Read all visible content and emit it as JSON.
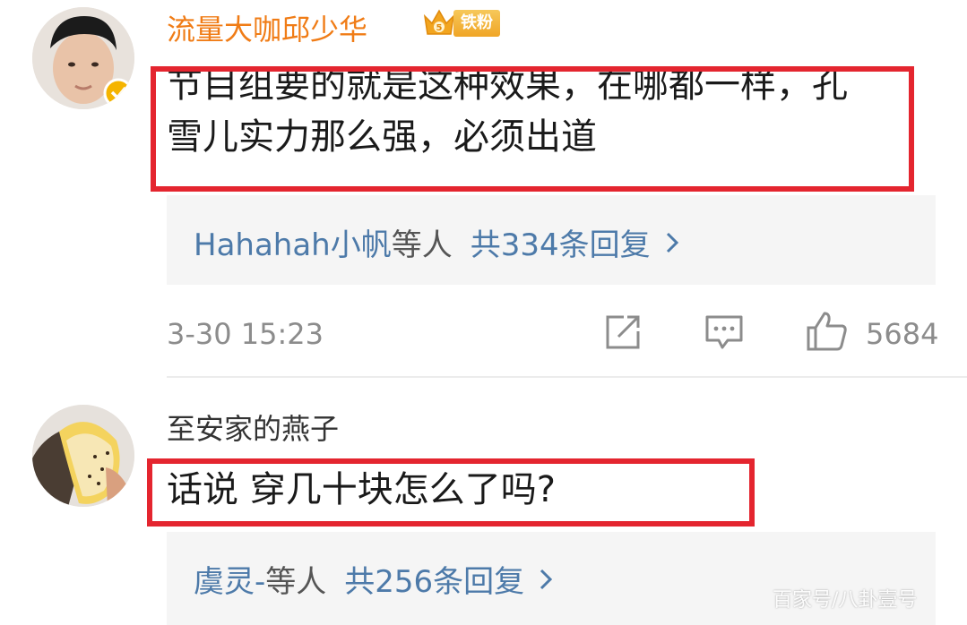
{
  "comments": [
    {
      "username": "流量大咖邱少华",
      "fan_badge": "铁粉",
      "text_line_1": "节目组要的就是这种效果，在哪都一样，孔",
      "text_line_2": "雪儿实力那么强，必须出道",
      "reply_users": "Hahahah小帆",
      "reply_suffix": "等人",
      "reply_count": "共334条回复",
      "timestamp": "3-30 15:23",
      "like_count": "5684"
    },
    {
      "username": "至安家的燕子",
      "text": "话说 穿几十块怎么了吗?",
      "reply_users": "虞灵-",
      "reply_suffix": "等人",
      "reply_count": "共256条回复"
    }
  ],
  "watermark": "百家号/八卦壹号",
  "colors": {
    "highlight_box": "#e4252f",
    "username_vip": "#f07c16",
    "link": "#4d7aa9",
    "reply_bg": "#f5f5f5"
  }
}
